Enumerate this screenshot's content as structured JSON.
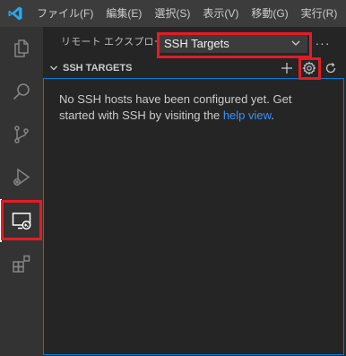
{
  "menu": {
    "items": [
      "ファイル(F)",
      "編集(E)",
      "選択(S)",
      "表示(V)",
      "移動(G)",
      "実行(R)"
    ]
  },
  "activity_bar": {
    "items": [
      {
        "name": "explorer",
        "icon": "files-icon"
      },
      {
        "name": "search",
        "icon": "search-icon"
      },
      {
        "name": "source-control",
        "icon": "source-control-icon"
      },
      {
        "name": "run-debug",
        "icon": "run-debug-icon"
      },
      {
        "name": "remote-explorer",
        "icon": "remote-explorer-icon",
        "active": true
      },
      {
        "name": "extensions",
        "icon": "extensions-icon"
      }
    ]
  },
  "sidebar": {
    "title": "リモート エクスプローラー",
    "target_select": "SSH Targets",
    "more_actions": "···"
  },
  "section": {
    "title": "SSH TARGETS",
    "actions": [
      "add-icon",
      "gear-icon",
      "refresh-icon"
    ]
  },
  "welcome": {
    "text_before": "No SSH hosts have been configured yet. Get started with SSH by visiting the ",
    "link": "help view",
    "text_after": "."
  },
  "colors": {
    "highlight": "#e51b24",
    "link": "#3794ff",
    "focus_border": "#007fd4",
    "vscode_blue": "#23a9f2"
  }
}
